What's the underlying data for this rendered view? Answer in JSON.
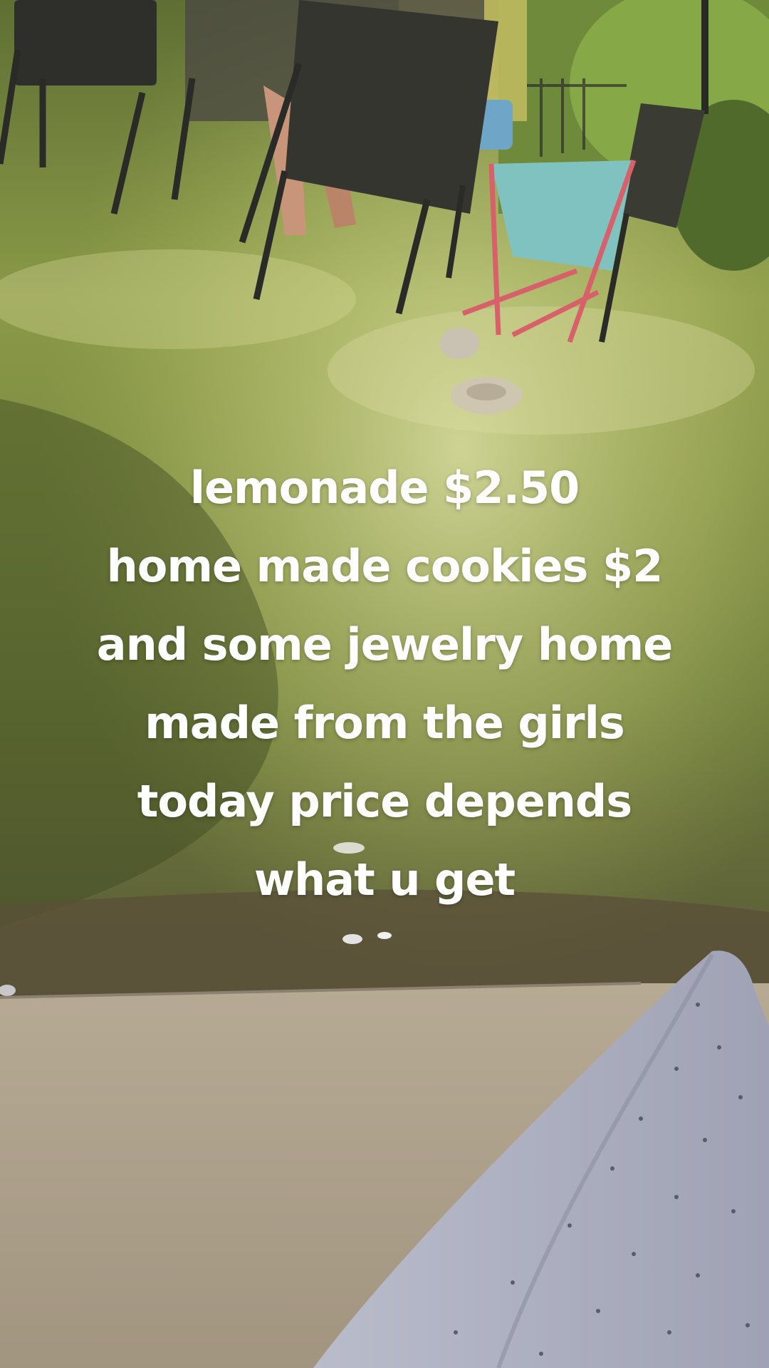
{
  "overlay_caption": {
    "lines": [
      "lemonade $2.50",
      "home made cookies $2",
      "and some jewelry home",
      "made from the girls",
      "today price depends",
      "what u get"
    ]
  }
}
